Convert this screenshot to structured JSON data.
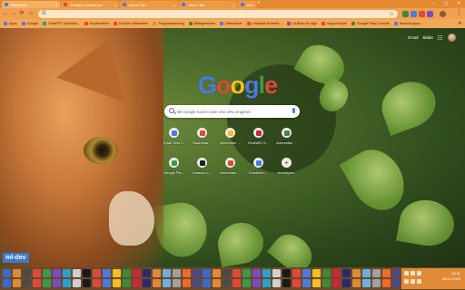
{
  "tabs": [
    {
      "title": "Startseite",
      "color": "#4a7be0"
    },
    {
      "title": "Einladen Dashboard",
      "color": "#e0483a"
    },
    {
      "title": "Neuer Tab",
      "color": "#4a7be0"
    },
    {
      "title": "Neuer Tab",
      "color": "#4a7be0"
    },
    {
      "title": "Neuer Tab",
      "color": "#4a7be0"
    }
  ],
  "new_tab_label": "+",
  "window_controls": {
    "minimize": "–",
    "maximize": "▢",
    "close": "✕"
  },
  "toolbar": {
    "back": "←",
    "forward": "→",
    "reload": "⟳",
    "home": "⌂",
    "omnibox_prefix": "G",
    "star": "☆",
    "menu": "⋮"
  },
  "bookmarks": [
    {
      "label": "Apps",
      "color": "#4a7be0"
    },
    {
      "label": "Google",
      "color": "#4a7be0"
    },
    {
      "label": "ChatGPT Optimize...",
      "color": "#10a37f"
    },
    {
      "label": "Kopfverteiler",
      "color": "#e0483a"
    },
    {
      "label": "Drucker Webseiten",
      "color": "#e0483a"
    },
    {
      "label": "Programmierung",
      "color": "#e08a38"
    },
    {
      "label": "Bildagenturen",
      "color": "#3a8a3a"
    },
    {
      "label": "Übersetzer",
      "color": "#4a7be0"
    },
    {
      "label": "Leseliste Erweiter...",
      "color": "#e0483a"
    },
    {
      "label": "Le Beau Ku Ago",
      "color": "#7a4ac0"
    },
    {
      "label": "mapper/Opel",
      "color": "#e0483a"
    },
    {
      "label": "Google Play Console",
      "color": "#3a8a3a"
    },
    {
      "label": "Android Apps ...",
      "color": "#4a7be0"
    }
  ],
  "bookmarks_more": "»",
  "top_links": {
    "gmail": "Gmail",
    "images": "Bilder"
  },
  "google_logo": [
    {
      "ch": "G",
      "color": "#4a7be0"
    },
    {
      "ch": "o",
      "color": "#e0483a"
    },
    {
      "ch": "o",
      "color": "#f2c020"
    },
    {
      "ch": "g",
      "color": "#4a7be0"
    },
    {
      "ch": "l",
      "color": "#3a9a4a"
    },
    {
      "ch": "e",
      "color": "#e0483a"
    }
  ],
  "search": {
    "placeholder": "Mit Google suchen oder eine URL eingeben"
  },
  "shortcuts": [
    {
      "label": "Erste Schri...",
      "color": "#4a7be0"
    },
    {
      "label": "Dashboar...",
      "color": "#e0483a"
    },
    {
      "label": "Anmelden ...",
      "color": "#f2c020"
    },
    {
      "label": "HUAWEI S...",
      "color": "#c8283a"
    },
    {
      "label": "Anmelden ...",
      "color": "#3a8a3a"
    },
    {
      "label": "Google Pla...",
      "color": "#3a9a4a"
    },
    {
      "label": "Amazon.c...",
      "color": "#222222"
    },
    {
      "label": "Anmelden ...",
      "color": "#e0483a"
    },
    {
      "label": "Einstellun...",
      "color": "#4a7be0"
    },
    {
      "label": "Verknüpfu...",
      "color": "#888888"
    }
  ],
  "shortcut_add_symbol": "+",
  "watermark": "ml-dev",
  "taskbar_colors": [
    "#3a6ad0",
    "#e08a38",
    "#4a4a4a",
    "#e0483a",
    "#3a9a4a",
    "#7a4ac0",
    "#2aa0d0",
    "#d0d0d0",
    "#1a1a1a",
    "#e0483a",
    "#4a7be0",
    "#f2c020",
    "#3a8a3a",
    "#c8283a",
    "#2a2a6a",
    "#e08a38",
    "#6ab0e0",
    "#a0a0a0",
    "#f06a2a",
    "#4a4a8a"
  ],
  "clock": {
    "time": "18:41",
    "date": "05.04.2023"
  }
}
